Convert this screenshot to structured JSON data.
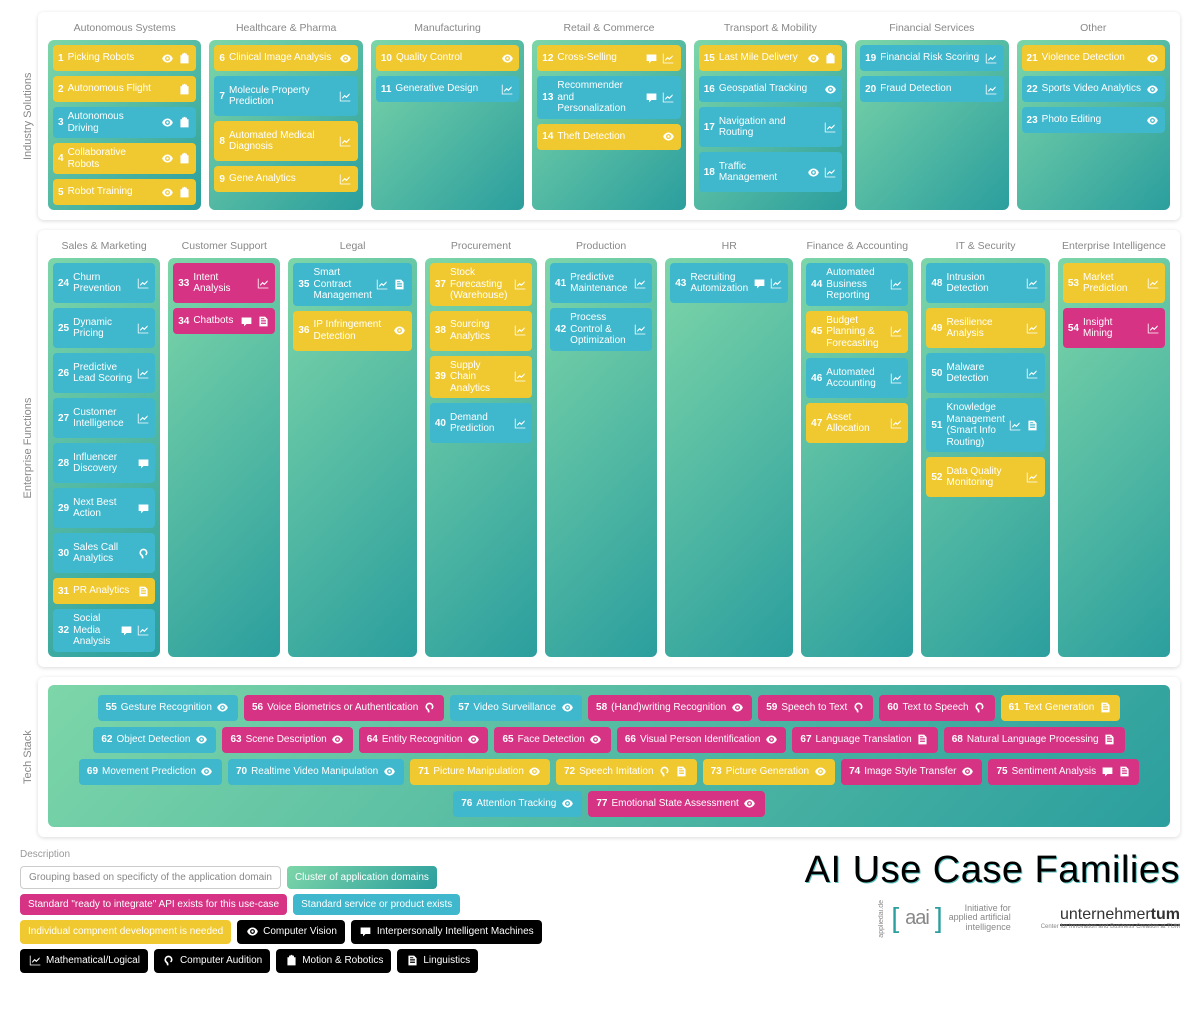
{
  "title": "AI Use Case Families",
  "sections": [
    {
      "label": "Industry Solutions",
      "columns": [
        {
          "header": "Autonomous Systems",
          "items": [
            {
              "n": 1,
              "t": "Picking Robots",
              "c": "yellow",
              "i": [
                "eye",
                "robot"
              ]
            },
            {
              "n": 2,
              "t": "Autonomous Flight",
              "c": "yellow",
              "i": [
                "robot"
              ]
            },
            {
              "n": 3,
              "t": "Autonomous Driving",
              "c": "blue",
              "i": [
                "eye",
                "robot"
              ]
            },
            {
              "n": 4,
              "t": "Collaborative Robots",
              "c": "yellow",
              "i": [
                "eye",
                "robot"
              ]
            },
            {
              "n": 5,
              "t": "Robot Training",
              "c": "yellow",
              "i": [
                "eye",
                "robot"
              ]
            }
          ]
        },
        {
          "header": "Healthcare & Pharma",
          "items": [
            {
              "n": 6,
              "t": "Clinical Image Analysis",
              "c": "yellow",
              "i": [
                "eye"
              ]
            },
            {
              "n": 7,
              "t": "Molecule Property Prediction",
              "c": "blue",
              "i": [
                "chart"
              ],
              "tall": true
            },
            {
              "n": 8,
              "t": "Automated Medical Diagnosis",
              "c": "yellow",
              "i": [
                "chart"
              ],
              "tall": true
            },
            {
              "n": 9,
              "t": "Gene Analytics",
              "c": "yellow",
              "i": [
                "chart"
              ]
            }
          ]
        },
        {
          "header": "Manufacturing",
          "items": [
            {
              "n": 10,
              "t": "Quality Control",
              "c": "yellow",
              "i": [
                "eye"
              ]
            },
            {
              "n": 11,
              "t": "Generative Design",
              "c": "blue",
              "i": [
                "chart"
              ]
            }
          ]
        },
        {
          "header": "Retail & Commerce",
          "items": [
            {
              "n": 12,
              "t": "Cross-Selling",
              "c": "yellow",
              "i": [
                "chat",
                "chart"
              ]
            },
            {
              "n": 13,
              "t": "Recommender and Personalization",
              "c": "blue",
              "i": [
                "chat",
                "chart"
              ],
              "tall": true
            },
            {
              "n": 14,
              "t": "Theft Detection",
              "c": "yellow",
              "i": [
                "eye"
              ]
            }
          ]
        },
        {
          "header": "Transport & Mobility",
          "items": [
            {
              "n": 15,
              "t": "Last Mile Delivery",
              "c": "yellow",
              "i": [
                "eye",
                "robot"
              ]
            },
            {
              "n": 16,
              "t": "Geospatial Tracking",
              "c": "blue",
              "i": [
                "eye"
              ]
            },
            {
              "n": 17,
              "t": "Navigation and Routing",
              "c": "blue",
              "i": [
                "chart"
              ],
              "tall": true
            },
            {
              "n": 18,
              "t": "Traffic Management",
              "c": "blue",
              "i": [
                "eye",
                "chart"
              ],
              "tall": true
            }
          ]
        },
        {
          "header": "Financial Services",
          "items": [
            {
              "n": 19,
              "t": "Financial Risk Scoring",
              "c": "blue",
              "i": [
                "chart"
              ]
            },
            {
              "n": 20,
              "t": "Fraud Detection",
              "c": "blue",
              "i": [
                "chart"
              ]
            }
          ]
        },
        {
          "header": "Other",
          "items": [
            {
              "n": 21,
              "t": "Violence Detection",
              "c": "yellow",
              "i": [
                "eye"
              ]
            },
            {
              "n": 22,
              "t": "Sports Video Analytics",
              "c": "blue",
              "i": [
                "eye"
              ]
            },
            {
              "n": 23,
              "t": "Photo Editing",
              "c": "blue",
              "i": [
                "eye"
              ]
            }
          ]
        }
      ]
    },
    {
      "label": "Enterprise Functions",
      "columns": [
        {
          "header": "Sales & Marketing",
          "items": [
            {
              "n": 24,
              "t": "Churn Prevention",
              "c": "blue",
              "i": [
                "chart"
              ],
              "tall": true
            },
            {
              "n": 25,
              "t": "Dynamic Pricing",
              "c": "blue",
              "i": [
                "chart"
              ],
              "tall": true
            },
            {
              "n": 26,
              "t": "Predictive Lead Scoring",
              "c": "blue",
              "i": [
                "chart"
              ],
              "tall": true
            },
            {
              "n": 27,
              "t": "Customer Intelligence",
              "c": "blue",
              "i": [
                "chart"
              ],
              "tall": true
            },
            {
              "n": 28,
              "t": "Influencer Discovery",
              "c": "blue",
              "i": [
                "chat"
              ],
              "tall": true
            },
            {
              "n": 29,
              "t": "Next Best Action",
              "c": "blue",
              "i": [
                "chat"
              ],
              "tall": true
            },
            {
              "n": 30,
              "t": "Sales Call Analytics",
              "c": "blue",
              "i": [
                "ear"
              ],
              "tall": true
            },
            {
              "n": 31,
              "t": "PR Analytics",
              "c": "yellow",
              "i": [
                "doc"
              ]
            },
            {
              "n": 32,
              "t": "Social Media Analysis",
              "c": "blue",
              "i": [
                "chat",
                "chart"
              ],
              "tall": true
            }
          ]
        },
        {
          "header": "Customer Support",
          "items": [
            {
              "n": 33,
              "t": "Intent Analysis",
              "c": "pink",
              "i": [
                "chart"
              ],
              "tall": true
            },
            {
              "n": 34,
              "t": "Chatbots",
              "c": "pink",
              "i": [
                "chat",
                "doc"
              ]
            }
          ]
        },
        {
          "header": "Legal",
          "items": [
            {
              "n": 35,
              "t": "Smart Contract Management",
              "c": "blue",
              "i": [
                "chart",
                "doc"
              ],
              "tall": true
            },
            {
              "n": 36,
              "t": "IP Infringement Detection",
              "c": "yellow",
              "i": [
                "eye"
              ],
              "tall": true
            }
          ]
        },
        {
          "header": "Procurement",
          "items": [
            {
              "n": 37,
              "t": "Stock Forecasting (Warehouse)",
              "c": "yellow",
              "i": [
                "chart"
              ],
              "tall": true
            },
            {
              "n": 38,
              "t": "Sourcing Analytics",
              "c": "yellow",
              "i": [
                "chart"
              ],
              "tall": true
            },
            {
              "n": 39,
              "t": "Supply Chain Analytics",
              "c": "yellow",
              "i": [
                "chart"
              ],
              "tall": true
            },
            {
              "n": 40,
              "t": "Demand Prediction",
              "c": "blue",
              "i": [
                "chart"
              ],
              "tall": true
            }
          ]
        },
        {
          "header": "Production",
          "items": [
            {
              "n": 41,
              "t": "Predictive Maintenance",
              "c": "blue",
              "i": [
                "chart"
              ],
              "tall": true
            },
            {
              "n": 42,
              "t": "Process Control & Optimization",
              "c": "blue",
              "i": [
                "chart"
              ],
              "tall": true
            }
          ]
        },
        {
          "header": "HR",
          "items": [
            {
              "n": 43,
              "t": "Recruiting Automization",
              "c": "blue",
              "i": [
                "chat",
                "chart"
              ],
              "tall": true
            }
          ]
        },
        {
          "header": "Finance & Accounting",
          "items": [
            {
              "n": 44,
              "t": "Automated Business Reporting",
              "c": "blue",
              "i": [
                "chart"
              ],
              "tall": true
            },
            {
              "n": 45,
              "t": "Budget Planning & Forecasting",
              "c": "yellow",
              "i": [
                "chart"
              ],
              "tall": true
            },
            {
              "n": 46,
              "t": "Automated Accounting",
              "c": "blue",
              "i": [
                "chart"
              ],
              "tall": true
            },
            {
              "n": 47,
              "t": "Asset Allocation",
              "c": "yellow",
              "i": [
                "chart"
              ],
              "tall": true
            }
          ]
        },
        {
          "header": "IT & Security",
          "items": [
            {
              "n": 48,
              "t": "Intrusion Detection",
              "c": "blue",
              "i": [
                "chart"
              ],
              "tall": true
            },
            {
              "n": 49,
              "t": "Resilience Analysis",
              "c": "yellow",
              "i": [
                "chart"
              ],
              "tall": true
            },
            {
              "n": 50,
              "t": "Malware Detection",
              "c": "blue",
              "i": [
                "chart"
              ],
              "tall": true
            },
            {
              "n": 51,
              "t": "Knowledge Management (Smart Info Routing)",
              "c": "blue",
              "i": [
                "chart",
                "doc"
              ],
              "tall": true
            },
            {
              "n": 52,
              "t": "Data Quality Monitoring",
              "c": "yellow",
              "i": [
                "chart"
              ],
              "tall": true
            }
          ]
        },
        {
          "header": "Enterprise Intelligence",
          "items": [
            {
              "n": 53,
              "t": "Market Prediction",
              "c": "yellow",
              "i": [
                "chart"
              ],
              "tall": true
            },
            {
              "n": 54,
              "t": "Insight Mining",
              "c": "pink",
              "i": [
                "chart"
              ],
              "tall": true
            }
          ]
        }
      ]
    }
  ],
  "tech": {
    "label": "Tech Stack",
    "items": [
      {
        "n": 55,
        "t": "Gesture Recognition",
        "c": "blue",
        "i": [
          "eye"
        ]
      },
      {
        "n": 56,
        "t": "Voice Biometrics or Authentication",
        "c": "pink",
        "i": [
          "ear"
        ]
      },
      {
        "n": 57,
        "t": "Video Surveillance",
        "c": "blue",
        "i": [
          "eye"
        ]
      },
      {
        "n": 58,
        "t": "(Hand)writing Recognition",
        "c": "pink",
        "i": [
          "eye"
        ]
      },
      {
        "n": 59,
        "t": "Speech to Text",
        "c": "pink",
        "i": [
          "ear"
        ]
      },
      {
        "n": 60,
        "t": "Text to Speech",
        "c": "pink",
        "i": [
          "ear"
        ]
      },
      {
        "n": 61,
        "t": "Text Generation",
        "c": "yellow",
        "i": [
          "doc"
        ]
      },
      {
        "n": 62,
        "t": "Object Detection",
        "c": "blue",
        "i": [
          "eye"
        ]
      },
      {
        "n": 63,
        "t": "Scene Description",
        "c": "pink",
        "i": [
          "eye"
        ]
      },
      {
        "n": 64,
        "t": "Entity Recognition",
        "c": "pink",
        "i": [
          "eye"
        ]
      },
      {
        "n": 65,
        "t": "Face Detection",
        "c": "pink",
        "i": [
          "eye"
        ]
      },
      {
        "n": 66,
        "t": "Visual Person Identification",
        "c": "pink",
        "i": [
          "eye"
        ]
      },
      {
        "n": 67,
        "t": "Language Translation",
        "c": "pink",
        "i": [
          "doc"
        ]
      },
      {
        "n": 68,
        "t": "Natural Language Processing",
        "c": "pink",
        "i": [
          "doc"
        ]
      },
      {
        "n": 69,
        "t": "Movement Prediction",
        "c": "blue",
        "i": [
          "eye"
        ]
      },
      {
        "n": 70,
        "t": "Realtime Video Manipulation",
        "c": "blue",
        "i": [
          "eye"
        ]
      },
      {
        "n": 71,
        "t": "Picture Manipulation",
        "c": "yellow",
        "i": [
          "eye"
        ]
      },
      {
        "n": 72,
        "t": "Speech Imitation",
        "c": "yellow",
        "i": [
          "ear",
          "doc"
        ]
      },
      {
        "n": 73,
        "t": "Picture Generation",
        "c": "yellow",
        "i": [
          "eye"
        ]
      },
      {
        "n": 74,
        "t": "Image Style Transfer",
        "c": "pink",
        "i": [
          "eye"
        ]
      },
      {
        "n": 75,
        "t": "Sentiment Analysis",
        "c": "pink",
        "i": [
          "chat",
          "doc"
        ]
      },
      {
        "n": 76,
        "t": "Attention Tracking",
        "c": "blue",
        "i": [
          "eye"
        ]
      },
      {
        "n": 77,
        "t": "Emotional State Assessment",
        "c": "pink",
        "i": [
          "eye"
        ]
      }
    ]
  },
  "legend": {
    "title": "Description",
    "rows": [
      [
        {
          "t": "Grouping based on specificty of the application domain",
          "k": "outline"
        },
        {
          "t": "Cluster of application domains",
          "k": "grad"
        }
      ],
      [
        {
          "t": "Standard \"ready to integrate\" API exists for this use-case",
          "k": "pink"
        },
        {
          "t": "Standard service or product exists",
          "k": "blue"
        }
      ],
      [
        {
          "t": "Individual compnent development is needed",
          "k": "yellow"
        },
        {
          "t": "Computer Vision",
          "k": "black",
          "i": "eye"
        },
        {
          "t": "Interpersonally Intelligent Machines",
          "k": "black",
          "i": "chat"
        }
      ],
      [
        {
          "t": "Mathematical/Logical",
          "k": "black",
          "i": "chart"
        },
        {
          "t": "Computer Audition",
          "k": "black",
          "i": "ear"
        },
        {
          "t": "Motion & Robotics",
          "k": "black",
          "i": "robot"
        },
        {
          "t": "Linguistics",
          "k": "black",
          "i": "doc"
        }
      ]
    ]
  },
  "logos": {
    "aai": {
      "bracket": "[aai]",
      "sub": "Initiative for\napplied artificial\nintelligence",
      "side": "appliedai.de"
    },
    "ut": {
      "main": "unternehmertum",
      "sub": "Center for Innovation and Business Creation at TUM"
    }
  }
}
